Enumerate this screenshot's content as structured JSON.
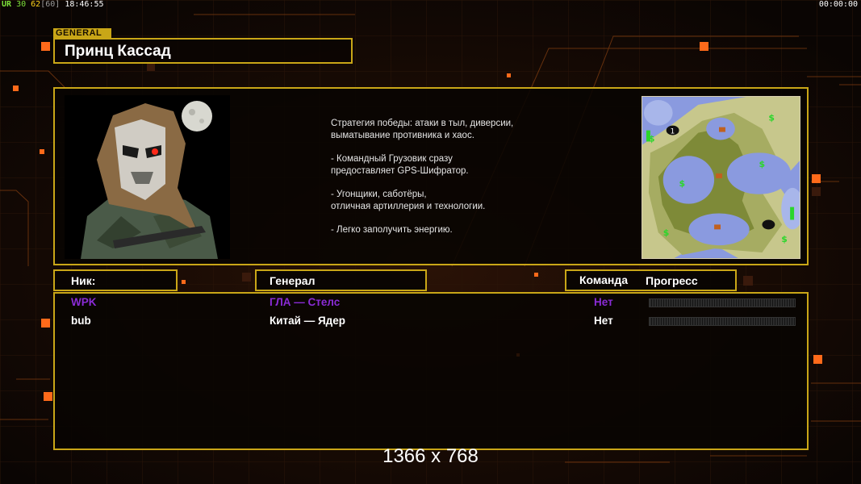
{
  "hud": {
    "left_prefix": "UR",
    "fps": "30",
    "fps_mid": "62",
    "fps_cap": "[60]",
    "clock": "18:46:55",
    "timer": "00:00:00"
  },
  "general_tag": "GENERAL",
  "general_name": "Принц Кассад",
  "strategy_lines": [
    "Стратегия победы: атаки в тыл, диверсии,\n выматывание противника и хаос.",
    "- Командный Грузовик сразу\nпредоставляет GPS-Шифратор.",
    "- Угонщики, саботёры,\nотличная артиллерия и технологии.",
    "- Легко заполучить энергию."
  ],
  "headers": {
    "nick": "Ник:",
    "general": "Генерал",
    "team": "Команда",
    "progress": "Прогресс"
  },
  "players": [
    {
      "nick": "WPK",
      "general": "ГЛА — Стелс",
      "team": "Нет",
      "color": "#8a2bd6",
      "progress": 0
    },
    {
      "nick": "bub",
      "general": "Китай — Ядер",
      "team": "Нет",
      "color": "#ffffff",
      "progress": 0
    }
  ],
  "resolution": "1366 x 768",
  "colors": {
    "frame": "#c9a617",
    "accent_orange": "#ff6a1a",
    "hud_green": "#7ee03a",
    "hud_yellow": "#ffd21a",
    "hud_gray": "#9a9a9a"
  }
}
